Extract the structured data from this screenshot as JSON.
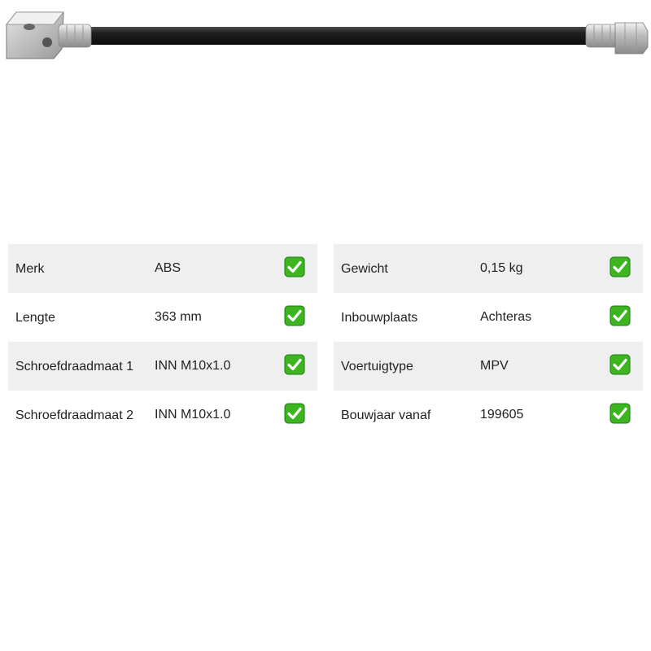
{
  "product": {
    "image_icon": "brake-hose-icon"
  },
  "specs": {
    "left": [
      {
        "label": "Merk",
        "value": "ABS",
        "check": "check-icon"
      },
      {
        "label": "Lengte",
        "value": "363 mm",
        "check": "check-icon"
      },
      {
        "label": "Schroefdraadmaat 1",
        "value": "INN M10x1.0",
        "check": "check-icon"
      },
      {
        "label": "Schroefdraadmaat 2",
        "value": "INN M10x1.0",
        "check": "check-icon"
      }
    ],
    "right": [
      {
        "label": "Gewicht",
        "value": "0,15 kg",
        "check": "check-icon"
      },
      {
        "label": "Inbouwplaats",
        "value": "Achteras",
        "check": "check-icon"
      },
      {
        "label": "Voertuigtype",
        "value": "MPV",
        "check": "check-icon"
      },
      {
        "label": "Bouwjaar vanaf",
        "value": "199605",
        "check": "check-icon"
      }
    ]
  },
  "colors": {
    "row_shade": "#efefef",
    "check_fill": "#3cb521",
    "check_border": "#1e7a14",
    "hose": "#1b1b1b"
  }
}
